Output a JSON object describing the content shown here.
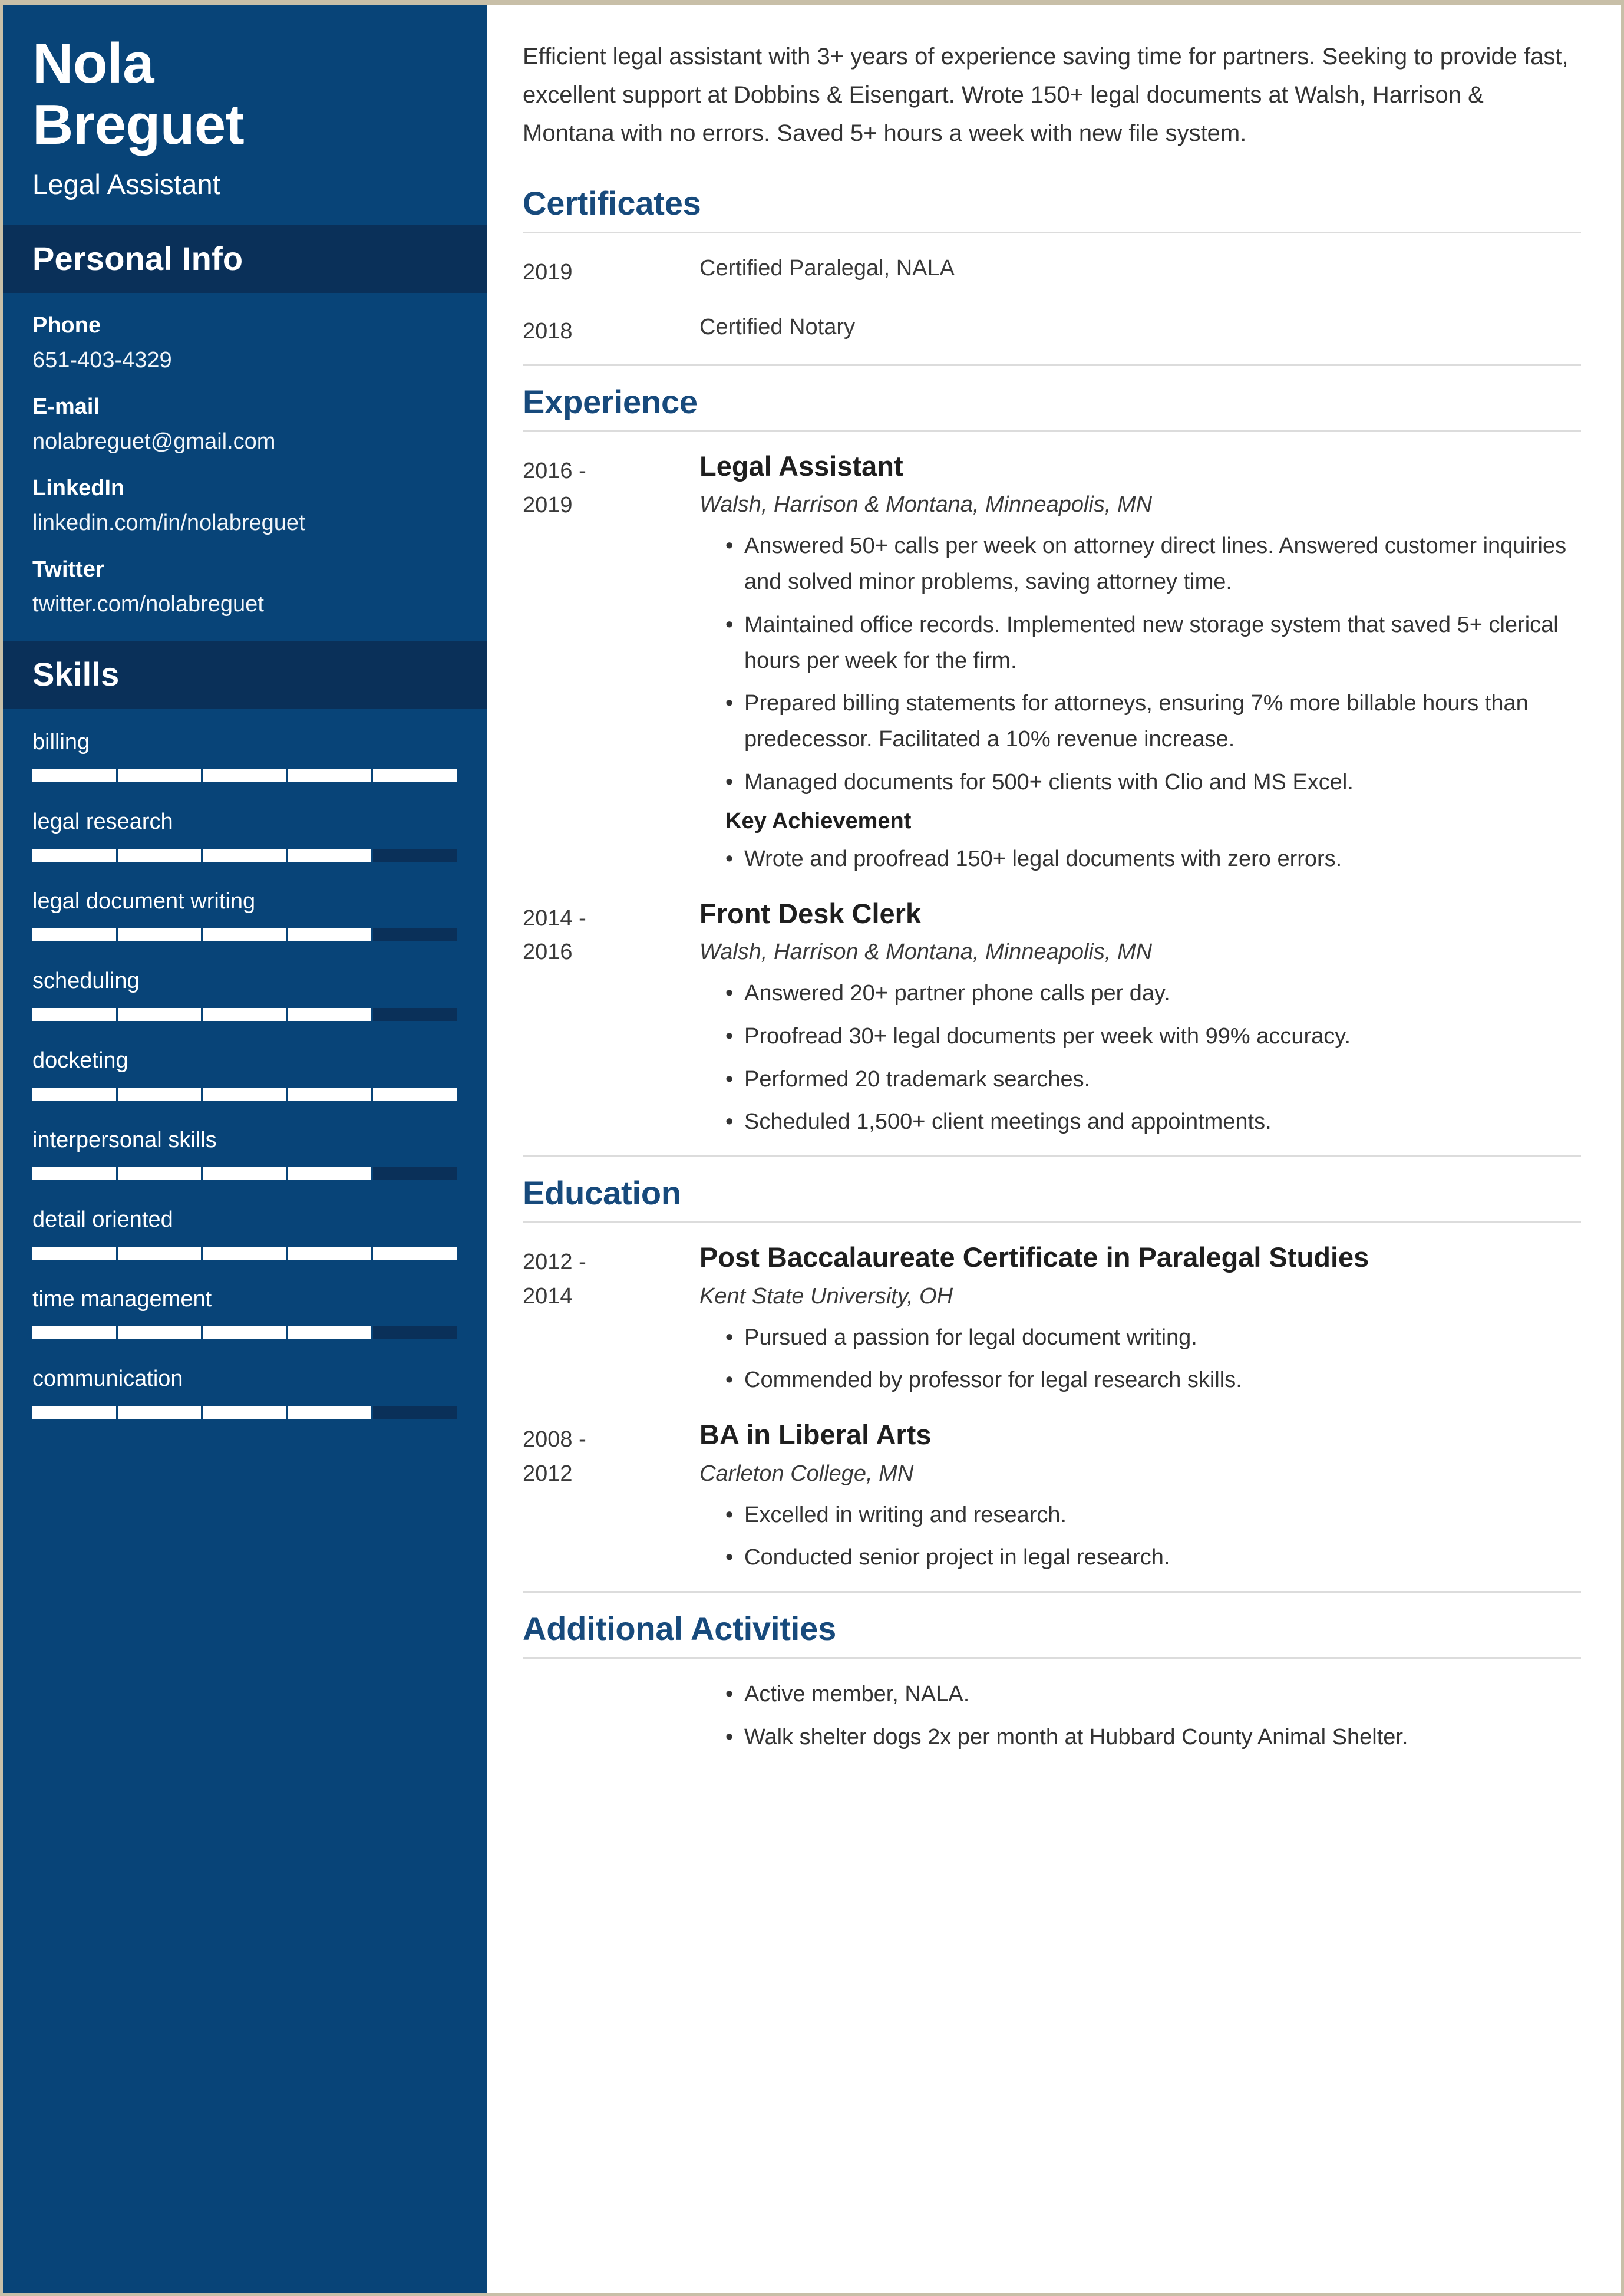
{
  "colors": {
    "sidebar_bg": "#084478",
    "sidebar_header_bg": "#0a3059",
    "accent_heading": "#174a7c",
    "skill_fill": "#ffffff",
    "skill_track": "#0a3059",
    "page_border": "#c8bfa8"
  },
  "sidebar": {
    "name_line1": "Nola",
    "name_line2": "Breguet",
    "job_title": "Legal Assistant",
    "personal_info": {
      "heading": "Personal Info",
      "items": [
        {
          "label": "Phone",
          "value": "651-403-4329"
        },
        {
          "label": "E-mail",
          "value": "nolabreguet@gmail.com"
        },
        {
          "label": "LinkedIn",
          "value": "linkedin.com/in/nolabreguet"
        },
        {
          "label": "Twitter",
          "value": "twitter.com/nolabreguet"
        }
      ]
    },
    "skills": {
      "heading": "Skills",
      "max_level": 5,
      "items": [
        {
          "name": "billing",
          "level": 5
        },
        {
          "name": "legal research",
          "level": 4
        },
        {
          "name": "legal document writing",
          "level": 4
        },
        {
          "name": "scheduling",
          "level": 4
        },
        {
          "name": "docketing",
          "level": 5
        },
        {
          "name": "interpersonal skills",
          "level": 4
        },
        {
          "name": "detail oriented",
          "level": 5
        },
        {
          "name": "time management",
          "level": 4
        },
        {
          "name": "communication",
          "level": 4
        }
      ]
    }
  },
  "main": {
    "summary": "Efficient legal assistant with 3+ years of experience saving time for partners. Seeking to provide fast, excellent support at Dobbins & Eisengart. Wrote 150+ legal documents at Walsh, Harrison & Montana with no errors. Saved 5+ hours a week with new file system.",
    "certificates": {
      "heading": "Certificates",
      "items": [
        {
          "year": "2019",
          "text": "Certified Paralegal, NALA"
        },
        {
          "year": "2018",
          "text": "Certified Notary"
        }
      ]
    },
    "experience": {
      "heading": "Experience",
      "entries": [
        {
          "date_start": "2016 -",
          "date_end": "2019",
          "title": "Legal Assistant",
          "subtitle": "Walsh, Harrison & Montana, Minneapolis, MN",
          "bullets": [
            "Answered 50+ calls per week on attorney direct lines. Answered customer inquiries and solved minor problems, saving attorney time.",
            "Maintained office records. Implemented new storage system that saved 5+ clerical hours per week for the firm.",
            "Prepared billing statements for attorneys, ensuring 7% more billable hours than predecessor. Facilitated a 10% revenue increase.",
            "Managed documents for 500+ clients with Clio and MS Excel."
          ],
          "key_achievement_label": "Key Achievement",
          "key_achievement_bullets": [
            "Wrote and proofread 150+ legal documents with zero errors."
          ]
        },
        {
          "date_start": "2014 -",
          "date_end": "2016",
          "title": "Front Desk Clerk",
          "subtitle": "Walsh, Harrison & Montana, Minneapolis, MN",
          "bullets": [
            "Answered 20+ partner phone calls per day.",
            "Proofread 30+ legal documents per week with 99% accuracy.",
            "Performed 20 trademark searches.",
            "Scheduled 1,500+ client meetings and appointments."
          ],
          "key_achievement_label": "",
          "key_achievement_bullets": []
        }
      ]
    },
    "education": {
      "heading": "Education",
      "entries": [
        {
          "date_start": "2012 -",
          "date_end": "2014",
          "title": "Post Baccalaureate Certificate in Paralegal Studies",
          "subtitle": "Kent State University, OH",
          "bullets": [
            "Pursued a passion for legal document writing.",
            "Commended by professor for legal research skills."
          ]
        },
        {
          "date_start": "2008 -",
          "date_end": "2012",
          "title": "BA in Liberal Arts",
          "subtitle": "Carleton College, MN",
          "bullets": [
            "Excelled in writing and research.",
            "Conducted senior project in legal research."
          ]
        }
      ]
    },
    "additional_activities": {
      "heading": "Additional Activities",
      "bullets": [
        "Active member, NALA.",
        "Walk shelter dogs 2x per month at Hubbard County Animal Shelter."
      ]
    }
  }
}
